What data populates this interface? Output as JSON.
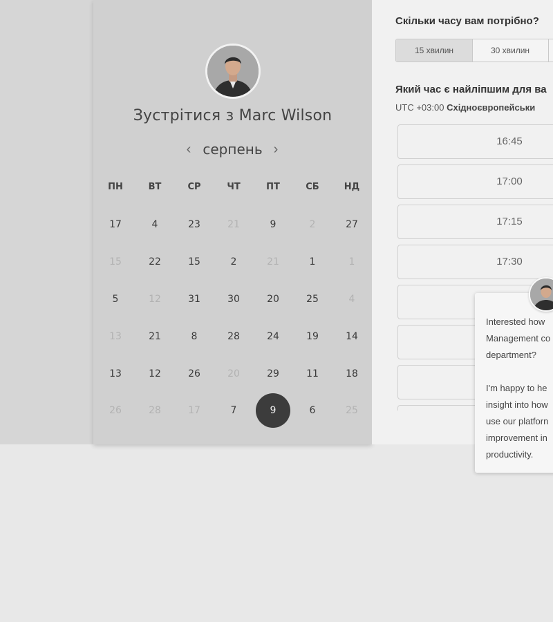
{
  "calendar": {
    "meet_title": "Зустрітися з Marc Wilson",
    "month": "серпень",
    "prev_icon": "‹",
    "next_icon": "›",
    "weekdays": [
      "ПН",
      "ВТ",
      "СР",
      "ЧТ",
      "ПТ",
      "СБ",
      "НД"
    ],
    "rows": [
      [
        {
          "d": "17",
          "m": false
        },
        {
          "d": "4",
          "m": false
        },
        {
          "d": "23",
          "m": false
        },
        {
          "d": "21",
          "m": true
        },
        {
          "d": "9",
          "m": false
        },
        {
          "d": "2",
          "m": true
        },
        {
          "d": "27",
          "m": false
        }
      ],
      [
        {
          "d": "15",
          "m": true
        },
        {
          "d": "22",
          "m": false
        },
        {
          "d": "15",
          "m": false
        },
        {
          "d": "2",
          "m": false
        },
        {
          "d": "21",
          "m": true
        },
        {
          "d": "1",
          "m": false
        },
        {
          "d": "1",
          "m": true
        }
      ],
      [
        {
          "d": "5",
          "m": false
        },
        {
          "d": "12",
          "m": true
        },
        {
          "d": "31",
          "m": false
        },
        {
          "d": "30",
          "m": false
        },
        {
          "d": "20",
          "m": false
        },
        {
          "d": "25",
          "m": false
        },
        {
          "d": "4",
          "m": true
        }
      ],
      [
        {
          "d": "13",
          "m": true
        },
        {
          "d": "21",
          "m": false
        },
        {
          "d": "8",
          "m": false
        },
        {
          "d": "28",
          "m": false
        },
        {
          "d": "24",
          "m": false
        },
        {
          "d": "19",
          "m": false
        },
        {
          "d": "14",
          "m": false
        }
      ],
      [
        {
          "d": "13",
          "m": false
        },
        {
          "d": "12",
          "m": false
        },
        {
          "d": "26",
          "m": false
        },
        {
          "d": "20",
          "m": true
        },
        {
          "d": "29",
          "m": false
        },
        {
          "d": "11",
          "m": false
        },
        {
          "d": "18",
          "m": false
        }
      ],
      [
        {
          "d": "26",
          "m": true
        },
        {
          "d": "28",
          "m": true
        },
        {
          "d": "17",
          "m": true
        },
        {
          "d": "7",
          "m": false
        },
        {
          "d": "9",
          "m": false,
          "selected": true
        },
        {
          "d": "6",
          "m": false
        },
        {
          "d": "25",
          "m": true
        }
      ]
    ]
  },
  "booking": {
    "duration_question": "Скільки часу вам потрібно?",
    "durations": [
      {
        "label": "15 хвилин",
        "active": true
      },
      {
        "label": "30 хвилин",
        "active": false
      },
      {
        "label": "",
        "active": false
      }
    ],
    "time_question": "Який час є найліпшим для ва",
    "timezone_prefix": "UTC +03:00 ",
    "timezone_name": "Східноєвропейськи",
    "slots": [
      "16:45",
      "17:00",
      "17:15",
      "17:30",
      "",
      "",
      "",
      ""
    ]
  },
  "chat": {
    "message": "Interested how\nManagement co\ndepartment?\n\nI'm happy to he\ninsight into how\nuse our platforn\nimprovement in\nproductivity."
  },
  "colors": {
    "selected_day": "#3c3c3c",
    "panel_bg": "#d0d0d0",
    "right_bg": "#f1f1f1"
  }
}
